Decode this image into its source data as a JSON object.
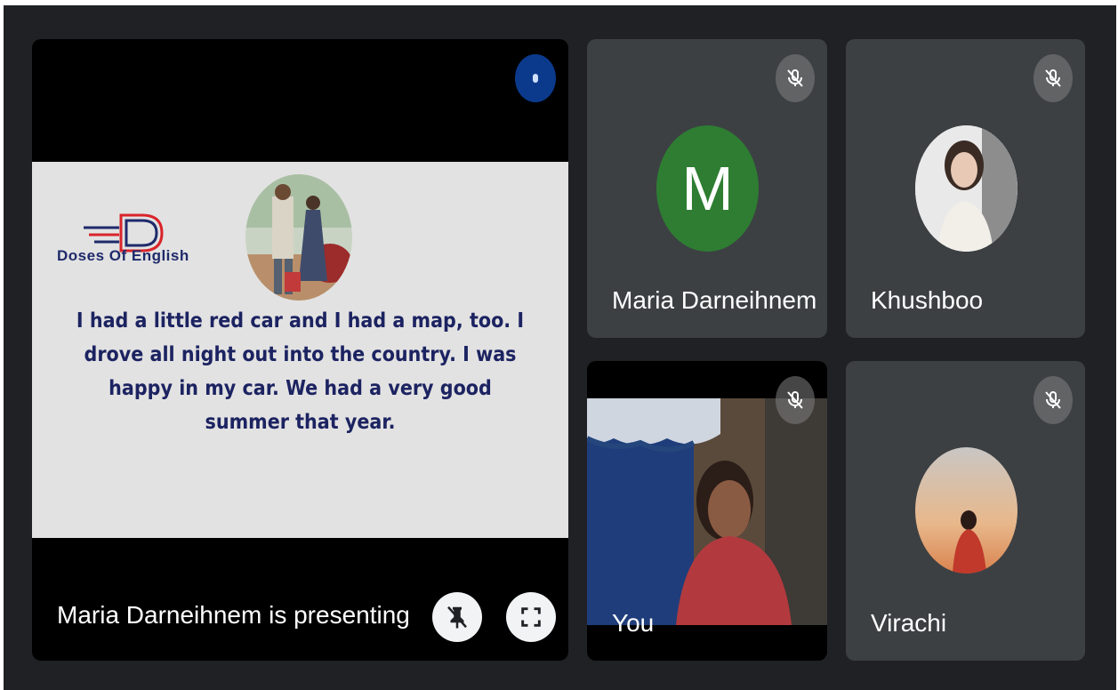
{
  "presentation": {
    "logo_text": "Doses Of English",
    "slide_text": "I had a little red car and I had a map, too. I drove all night out into the country. I was happy in my car. We had a very good summer that year.",
    "presenting_label": "Maria Darneihnem is presenting",
    "icons": {
      "speaking": "speaking-indicator-icon",
      "unpin": "unpin-icon",
      "fullscreen": "fullscreen-icon"
    }
  },
  "participants": [
    {
      "name": "Maria Darneihnem",
      "avatar_letter": "M",
      "avatar_color": "#2e7d32",
      "muted": true
    },
    {
      "name": "Khushboo",
      "muted": true
    },
    {
      "name": "You",
      "muted": true
    },
    {
      "name": "Virachi",
      "muted": true
    }
  ],
  "colors": {
    "background": "#202124",
    "tile": "#3c4043",
    "slide_text": "#1c2361",
    "speaking_dot": "#0b3a8c"
  }
}
